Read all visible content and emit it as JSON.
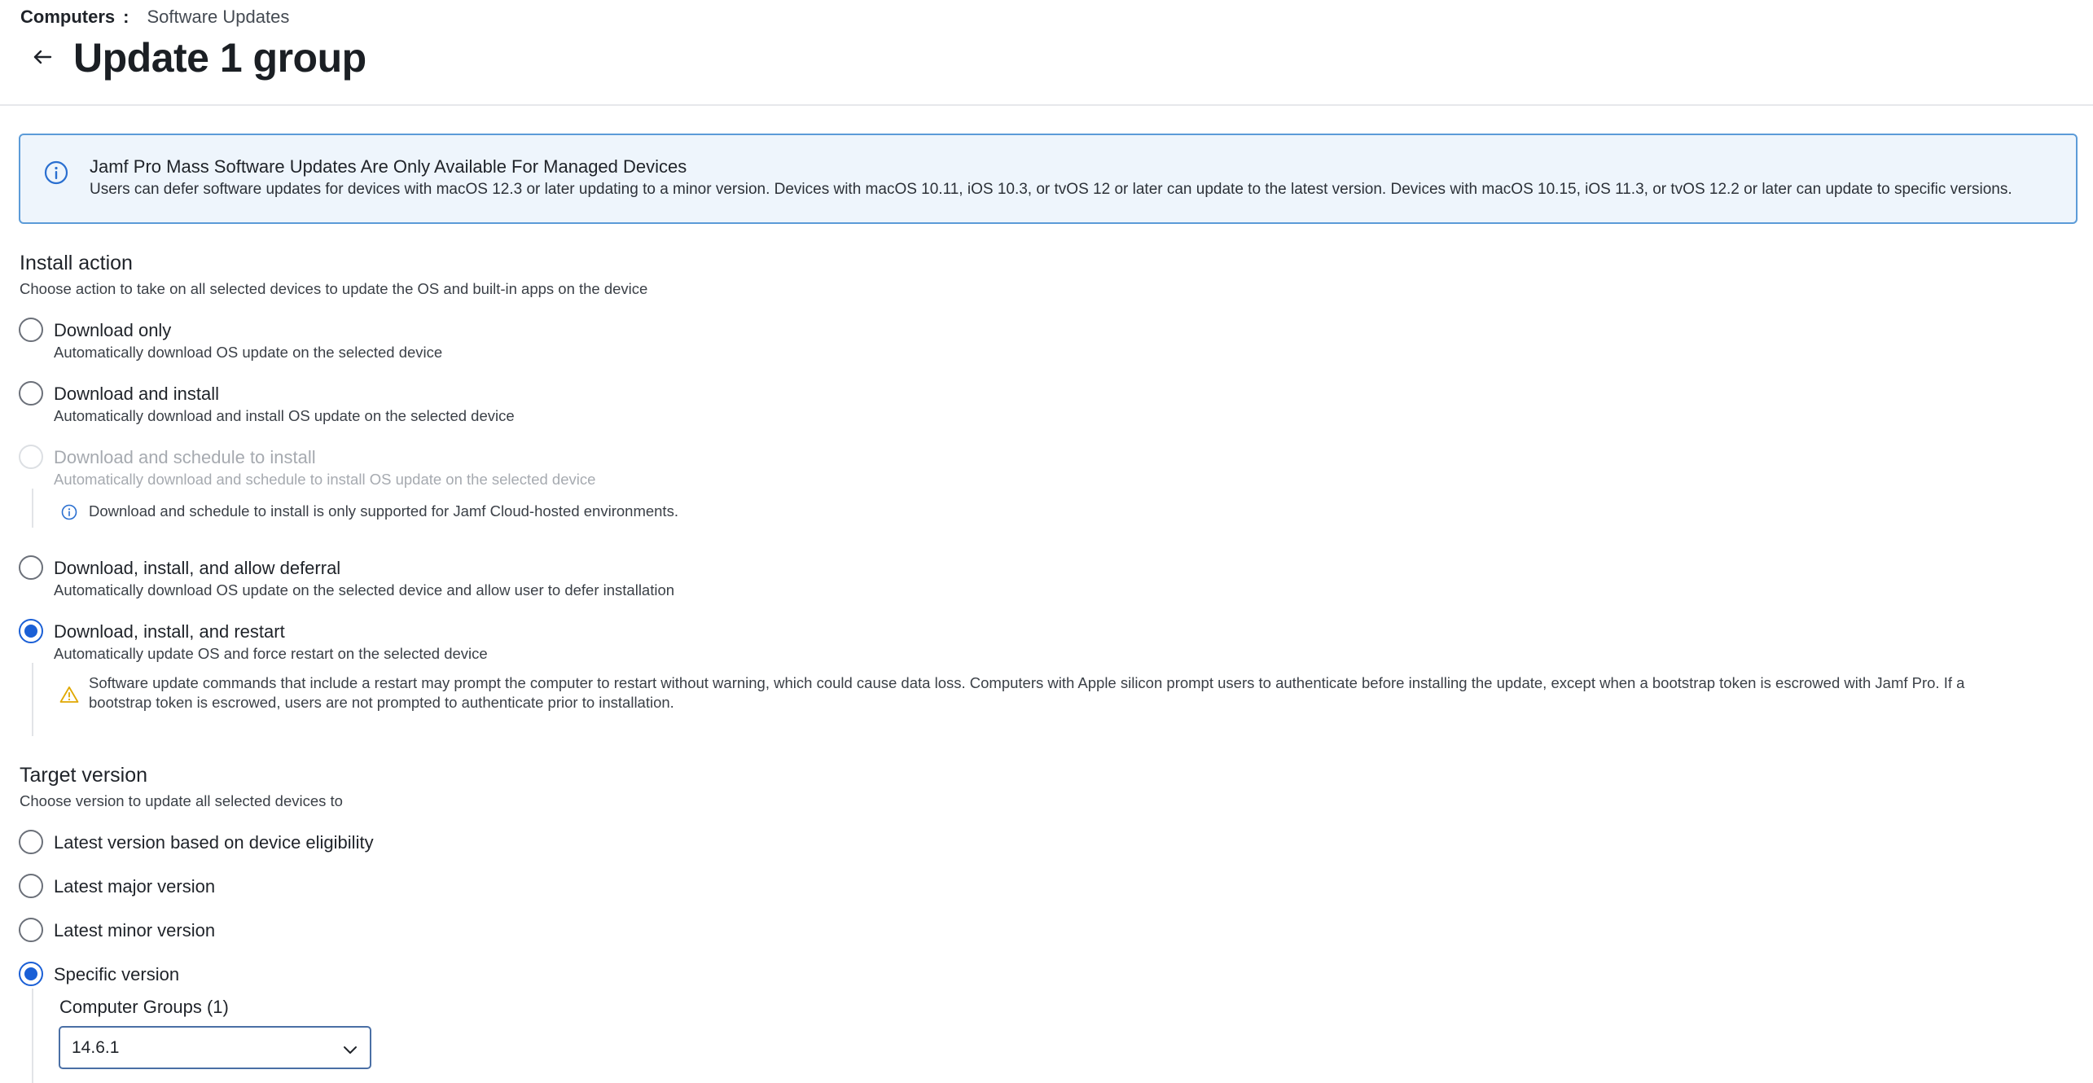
{
  "breadcrumb": {
    "root": "Computers",
    "separator": ":",
    "current": "Software Updates"
  },
  "page": {
    "title": "Update 1 group"
  },
  "banner": {
    "icon": "info-icon",
    "title": "Jamf Pro Mass Software Updates Are Only Available For Managed Devices",
    "text": "Users can defer software updates for devices with macOS 12.3 or later updating to a minor version. Devices with macOS 10.11, iOS 10.3, or tvOS 12 or later can update to the latest version. Devices with macOS 10.15, iOS 11.3, or tvOS 12.2 or later can update to specific versions."
  },
  "install_action": {
    "title": "Install action",
    "description": "Choose action to take on all selected devices to update the OS and built-in apps on the device",
    "selected": "download_install_restart",
    "options": [
      {
        "id": "download_only",
        "label": "Download only",
        "description": "Automatically download OS update on the selected device",
        "disabled": false,
        "checked": false
      },
      {
        "id": "download_install",
        "label": "Download and install",
        "description": "Automatically download and install OS update on the selected device",
        "disabled": false,
        "checked": false
      },
      {
        "id": "download_schedule",
        "label": "Download and schedule to install",
        "description": "Automatically download and schedule to install OS update on the selected device",
        "disabled": true,
        "checked": false,
        "note": "Download and schedule to install is only supported for Jamf Cloud-hosted environments."
      },
      {
        "id": "download_install_deferral",
        "label": "Download, install, and allow deferral",
        "description": "Automatically download OS update on the selected device and allow user to defer installation",
        "disabled": false,
        "checked": false
      },
      {
        "id": "download_install_restart",
        "label": "Download, install, and restart",
        "description": "Automatically update OS and force restart on the selected device",
        "disabled": false,
        "checked": true,
        "warning_line1": "Software update commands that include a restart may prompt the computer to restart without warning, which could cause data loss. Computers with Apple silicon prompt users to authenticate before installing the update, except when a bootstrap token is escrowed with Jamf Pro. If a",
        "warning_line2": "bootstrap token is escrowed, users are not prompted to authenticate prior to installation."
      }
    ]
  },
  "target_version": {
    "title": "Target version",
    "description": "Choose version to update all selected devices to",
    "options": [
      {
        "id": "latest_eligible",
        "label": "Latest version based on device eligibility",
        "checked": false
      },
      {
        "id": "latest_major",
        "label": "Latest major version",
        "checked": false
      },
      {
        "id": "latest_minor",
        "label": "Latest minor version",
        "checked": false
      },
      {
        "id": "specific",
        "label": "Specific version",
        "checked": true
      }
    ],
    "group_label": "Computer Groups (1)",
    "selected_version": "14.6.1"
  },
  "colors": {
    "accent": "#1a5fd6",
    "banner_bg": "#eef5fc",
    "banner_border": "#5b9bd8",
    "warning": "#e0a800",
    "info": "#2a6fd0"
  }
}
